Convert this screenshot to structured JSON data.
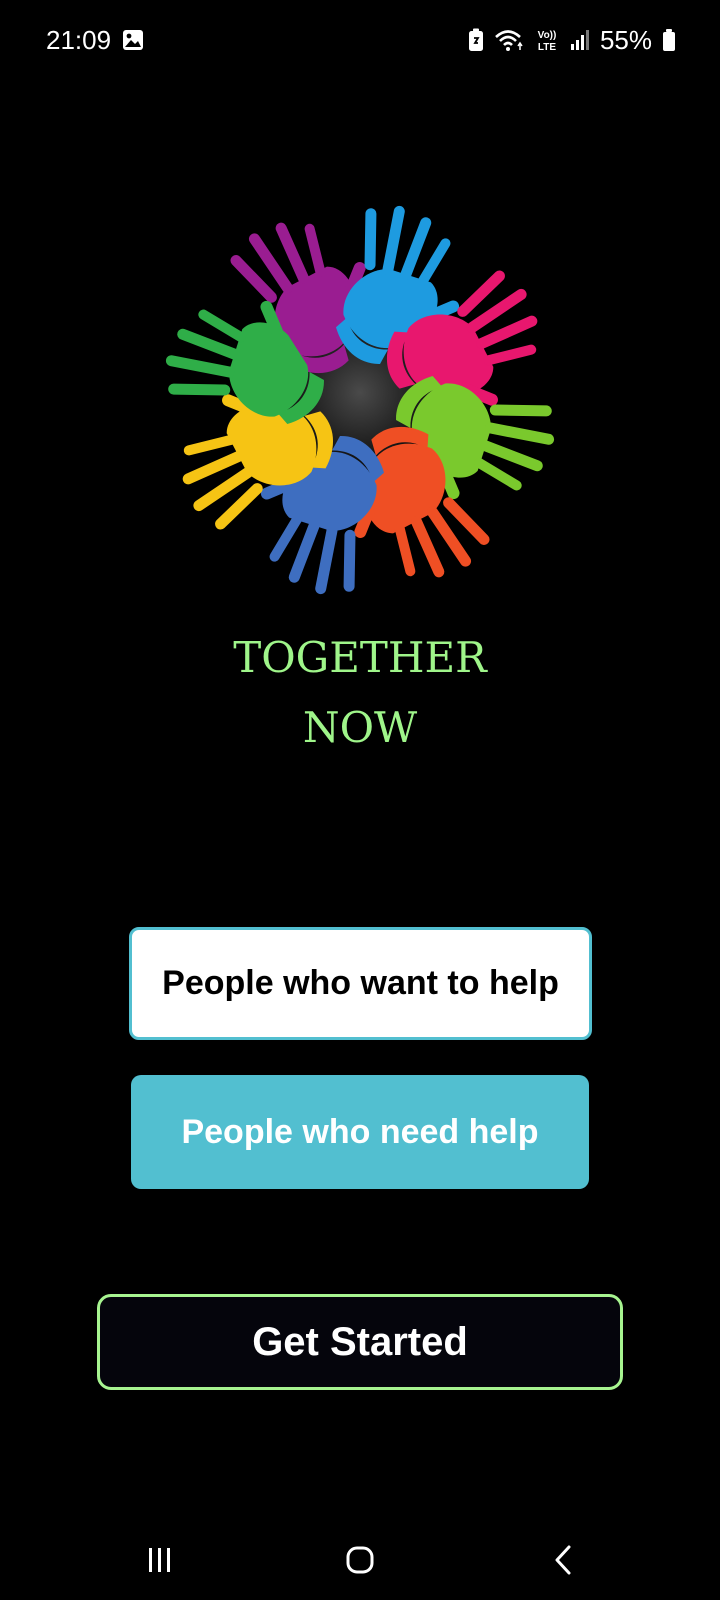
{
  "status_bar": {
    "time": "21:09",
    "battery_percent": "55%",
    "network_label": "Vo)) LTE",
    "icons": [
      "gallery-icon",
      "battery-saver-icon",
      "wifi-icon",
      "volte-icon",
      "signal-icon",
      "battery-icon"
    ]
  },
  "brand": {
    "line1": "TOGETHER",
    "line2": "NOW",
    "text_color": "#9ff58a",
    "logo_icon": "colorful-hands-circle-logo",
    "hand_colors": [
      "#1e9be0",
      "#e8176e",
      "#7ac92d",
      "#ef4f24",
      "#3e6ec0",
      "#f6c414",
      "#2fae48",
      "#9a1d91"
    ]
  },
  "buttons": {
    "want_help_label": "People who want to help",
    "need_help_label": "People who need help",
    "get_started_label": "Get Started"
  },
  "colors": {
    "accent_teal": "#52bfd0",
    "accent_green": "#a7f490",
    "background": "#000000"
  },
  "nav_bar": {
    "icons": [
      "recents-icon",
      "home-icon",
      "back-icon"
    ]
  }
}
